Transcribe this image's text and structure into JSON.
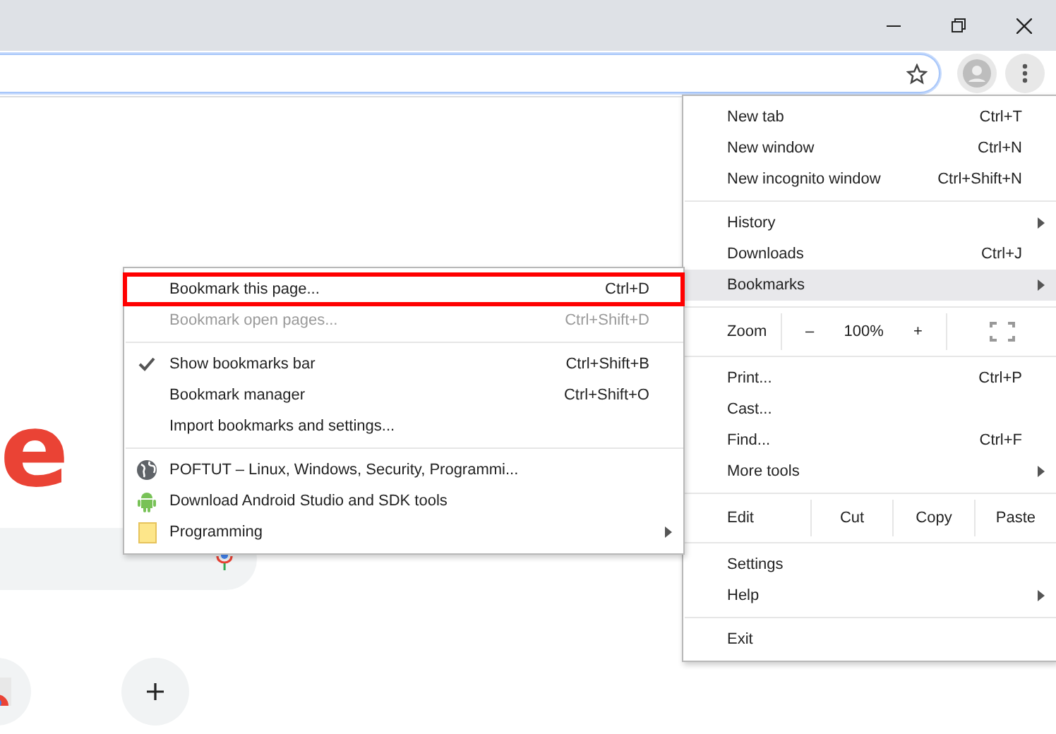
{
  "page": {
    "logo_fragment": "e"
  },
  "main_menu": {
    "items": [
      {
        "kind": "item",
        "label": "New tab",
        "shortcut": "Ctrl+T",
        "submenu": false,
        "selected": false
      },
      {
        "kind": "item",
        "label": "New window",
        "shortcut": "Ctrl+N",
        "submenu": false,
        "selected": false
      },
      {
        "kind": "item",
        "label": "New incognito window",
        "shortcut": "Ctrl+Shift+N",
        "submenu": false,
        "selected": false
      },
      {
        "kind": "separator"
      },
      {
        "kind": "item",
        "label": "History",
        "submenu": true,
        "selected": false
      },
      {
        "kind": "item",
        "label": "Downloads",
        "shortcut": "Ctrl+J",
        "submenu": false,
        "selected": false
      },
      {
        "kind": "item",
        "label": "Bookmarks",
        "submenu": true,
        "selected": true
      },
      {
        "kind": "separator"
      },
      {
        "kind": "zoom",
        "label": "Zoom",
        "minus": "–",
        "value": "100%",
        "plus": "+"
      },
      {
        "kind": "separator"
      },
      {
        "kind": "item",
        "label": "Print...",
        "shortcut": "Ctrl+P",
        "submenu": false,
        "selected": false
      },
      {
        "kind": "item",
        "label": "Cast...",
        "submenu": false,
        "selected": false
      },
      {
        "kind": "item",
        "label": "Find...",
        "shortcut": "Ctrl+F",
        "submenu": false,
        "selected": false
      },
      {
        "kind": "item",
        "label": "More tools",
        "submenu": true,
        "selected": false
      },
      {
        "kind": "separator"
      },
      {
        "kind": "edit",
        "label": "Edit",
        "buttons": [
          "Cut",
          "Copy",
          "Paste"
        ]
      },
      {
        "kind": "separator"
      },
      {
        "kind": "item",
        "label": "Settings",
        "submenu": false,
        "selected": false
      },
      {
        "kind": "item",
        "label": "Help",
        "submenu": true,
        "selected": false
      },
      {
        "kind": "separator"
      },
      {
        "kind": "item",
        "label": "Exit",
        "submenu": false,
        "selected": false
      }
    ]
  },
  "bookmarks_menu": {
    "items": [
      {
        "kind": "item",
        "label": "Bookmark this page...",
        "shortcut": "Ctrl+D",
        "highlighted": true,
        "disabled": false,
        "checked": false,
        "submenu": false
      },
      {
        "kind": "item",
        "label": "Bookmark open pages...",
        "shortcut": "Ctrl+Shift+D",
        "highlighted": false,
        "disabled": true,
        "checked": false,
        "submenu": false
      },
      {
        "kind": "separator"
      },
      {
        "kind": "item",
        "label": "Show bookmarks bar",
        "shortcut": "Ctrl+Shift+B",
        "highlighted": false,
        "disabled": false,
        "checked": true,
        "submenu": false
      },
      {
        "kind": "item",
        "label": "Bookmark manager",
        "shortcut": "Ctrl+Shift+O",
        "highlighted": false,
        "disabled": false,
        "checked": false,
        "submenu": false
      },
      {
        "kind": "item",
        "label": "Import bookmarks and settings...",
        "highlighted": false,
        "disabled": false,
        "checked": false,
        "submenu": false
      },
      {
        "kind": "separator"
      },
      {
        "kind": "site",
        "label": "POFTUT – Linux, Windows, Security, Programmi...",
        "highlighted": false,
        "disabled": false,
        "submenu": false
      },
      {
        "kind": "app",
        "label": "Download Android Studio and SDK tools",
        "highlighted": false,
        "disabled": false,
        "submenu": false
      },
      {
        "kind": "folder",
        "label": "Programming",
        "highlighted": false,
        "disabled": false,
        "submenu": true
      }
    ]
  }
}
